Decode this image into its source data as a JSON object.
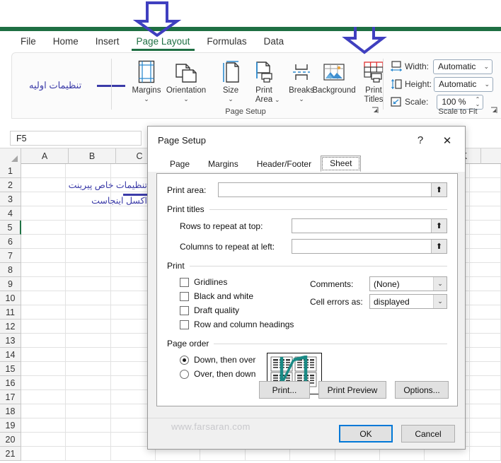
{
  "ribbon": {
    "tabs": [
      {
        "label": "File",
        "active": false
      },
      {
        "label": "Home",
        "active": false
      },
      {
        "label": "Insert",
        "active": false
      },
      {
        "label": "Page Layout",
        "active": true
      },
      {
        "label": "Formulas",
        "active": false
      },
      {
        "label": "Data",
        "active": false
      }
    ],
    "annotation_note": "تنظیمات اولیه",
    "page_setup_group": {
      "name": "Page Setup",
      "buttons": [
        {
          "label": "Margins",
          "icon": "margins-icon",
          "caret": "⌄"
        },
        {
          "label": "Orientation",
          "icon": "orientation-icon",
          "caret": "⌄"
        },
        {
          "label": "Size",
          "icon": "size-icon",
          "caret": "⌄"
        },
        {
          "label": "Print\nArea",
          "icon": "print-area-icon",
          "caret": "⌄"
        },
        {
          "label": "Breaks",
          "icon": "breaks-icon",
          "caret": "⌄"
        },
        {
          "label": "Background",
          "icon": "background-icon",
          "caret": ""
        },
        {
          "label": "Print\nTitles",
          "icon": "print-titles-icon",
          "caret": ""
        }
      ],
      "launcher_icon": "dialog-launcher-icon"
    },
    "scale_to_fit_group": {
      "name": "Scale to Fit",
      "width_label": "Width:",
      "width_value": "Automatic",
      "height_label": "Height:",
      "height_value": "Automatic",
      "scale_label": "Scale:",
      "scale_value": "100 %",
      "launcher_icon": "dialog-launcher-icon"
    }
  },
  "formula_bar": {
    "name_box_value": "F5"
  },
  "sheet": {
    "columns": [
      "A",
      "B",
      "C",
      "K"
    ],
    "rows": [
      1,
      2,
      3,
      4,
      5,
      6,
      7,
      8,
      9,
      10,
      11,
      12,
      13,
      14,
      15,
      16,
      17,
      18,
      19,
      20,
      21
    ],
    "selected_row": 5,
    "annotation_line1": "تنظیمات خاص پیرینت",
    "annotation_line2": "اکسل اینجاست"
  },
  "dialog": {
    "title": "Page Setup",
    "help_icon": "?",
    "close_icon": "✕",
    "tabs": [
      {
        "label": "Page",
        "active": false
      },
      {
        "label": "Margins",
        "active": false
      },
      {
        "label": "Header/Footer",
        "active": false
      },
      {
        "label": "Sheet",
        "active": true
      }
    ],
    "print_area_label": "Print area:",
    "print_area_value": "",
    "print_titles_group": "Print titles",
    "rows_repeat_label": "Rows to repeat at top:",
    "rows_repeat_value": "",
    "cols_repeat_label": "Columns to repeat at left:",
    "cols_repeat_value": "",
    "print_group": "Print",
    "checkboxes": [
      {
        "label": "Gridlines",
        "checked": false
      },
      {
        "label": "Black and white",
        "checked": false
      },
      {
        "label": "Draft quality",
        "checked": false
      },
      {
        "label": "Row and column headings",
        "checked": false
      }
    ],
    "comments_label": "Comments:",
    "comments_value": "(None)",
    "cell_errors_label": "Cell errors as:",
    "cell_errors_value": "displayed",
    "page_order_group": "Page order",
    "page_order_options": [
      {
        "label": "Down, then over",
        "selected": true
      },
      {
        "label": "Over, then down",
        "selected": false
      }
    ],
    "page_order_preview_icon": "page-order-preview-icon",
    "buttons": {
      "print": "Print...",
      "print_preview": "Print Preview",
      "options": "Options...",
      "ok": "OK",
      "cancel": "Cancel"
    }
  },
  "watermark": "www.farsaran.com",
  "colors": {
    "excel_green": "#1e6f43",
    "annotation_blue": "#3b3ba8",
    "arrow_blue": "#3f3fbf",
    "accent_blue": "#0078d7",
    "teal": "#1a8a85"
  }
}
